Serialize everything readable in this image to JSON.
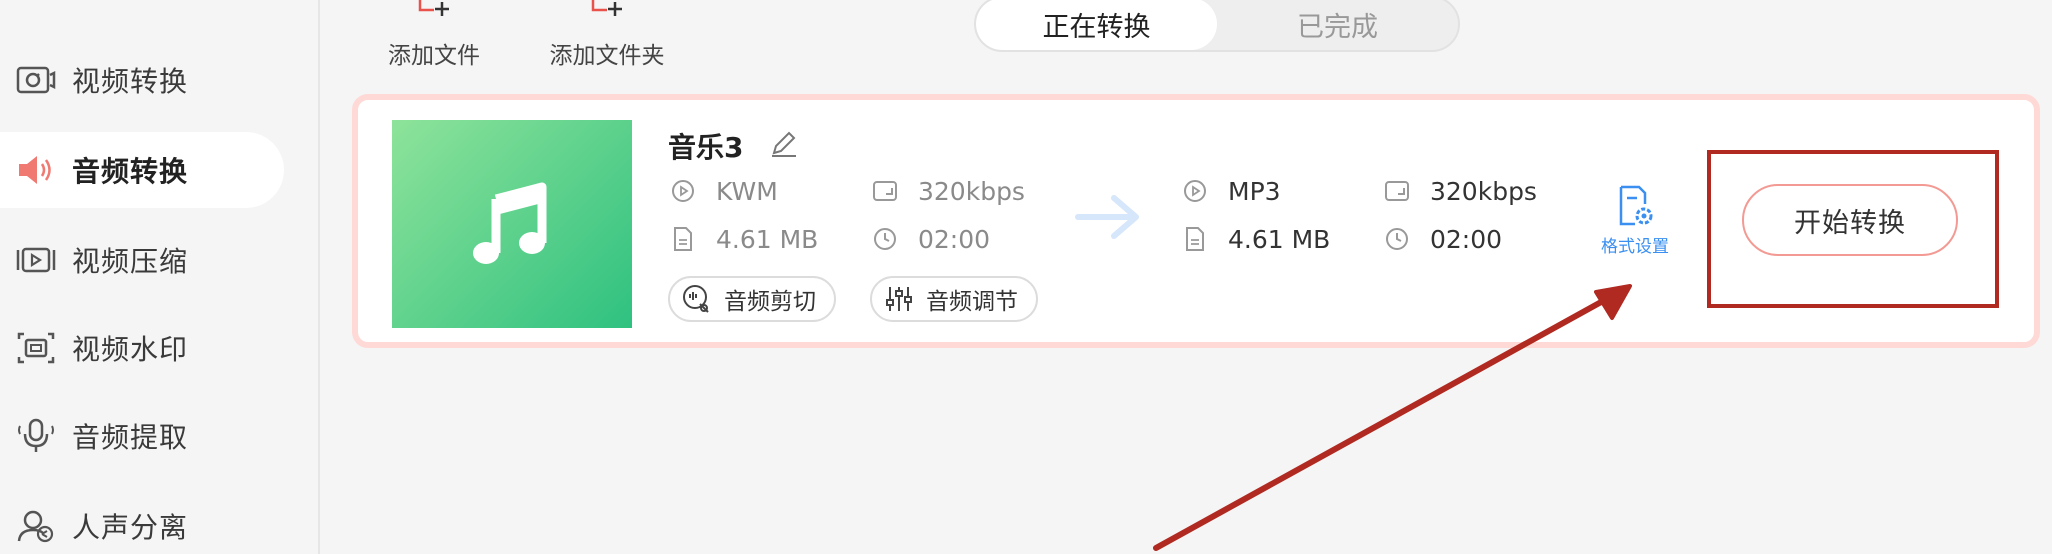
{
  "sidebar": {
    "items": [
      {
        "label": "视频转换",
        "icon": "video-convert-icon",
        "active": false
      },
      {
        "label": "音频转换",
        "icon": "audio-speaker-icon",
        "active": true
      },
      {
        "label": "视频压缩",
        "icon": "video-compress-icon",
        "active": false
      },
      {
        "label": "视频水印",
        "icon": "video-watermark-icon",
        "active": false
      },
      {
        "label": "音频提取",
        "icon": "microphone-icon",
        "active": false
      },
      {
        "label": "人声分离",
        "icon": "voice-separate-icon",
        "active": false
      }
    ]
  },
  "toolbar": {
    "add_file_label": "添加文件",
    "add_folder_label": "添加文件夹"
  },
  "tabs": {
    "converting": "正在转换",
    "completed": "已完成"
  },
  "task": {
    "name": "音乐3",
    "source": {
      "format": "KWM",
      "bitrate": "320kbps",
      "size": "4.61 MB",
      "duration": "02:00"
    },
    "target": {
      "format": "MP3",
      "bitrate": "320kbps",
      "size": "4.61 MB",
      "duration": "02:00"
    },
    "actions": {
      "cut": "音频剪切",
      "adjust": "音频调节",
      "format_settings": "格式设置",
      "start": "开始转换"
    }
  },
  "colors": {
    "accent_pink": "#f29a93",
    "card_border": "#ffd9d6",
    "link_blue": "#3a8ff0",
    "annotation_red": "#b02a22",
    "thumb_green": "#2fc180"
  }
}
